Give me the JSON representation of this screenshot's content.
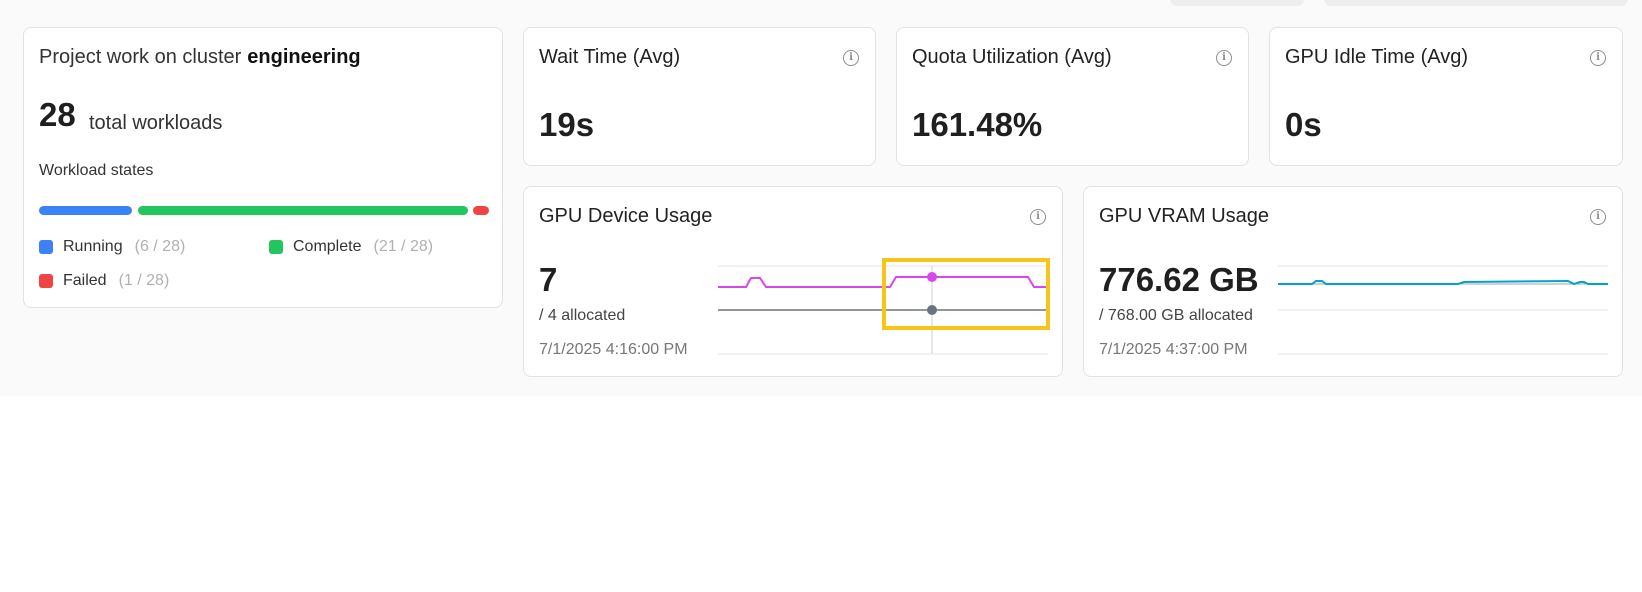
{
  "project": {
    "title_prefix": "Project work on cluster",
    "cluster": "engineering",
    "total": "28",
    "total_label": "total workloads",
    "states_label": "Workload states",
    "states": [
      {
        "name": "Running",
        "count": "(6 / 28)",
        "value": 6,
        "color": "#3b82f6"
      },
      {
        "name": "Complete",
        "count": "(21 / 28)",
        "value": 21,
        "color": "#22c55e"
      },
      {
        "name": "Failed",
        "count": "(1 / 28)",
        "value": 1,
        "color": "#ef4444"
      }
    ]
  },
  "metrics": [
    {
      "title": "Wait Time (Avg)",
      "value": "19s",
      "icon": "info-icon"
    },
    {
      "title": "Quota Utilization (Avg)",
      "value": "161.48%",
      "icon": "info-icon"
    },
    {
      "title": "GPU Idle Time (Avg)",
      "value": "0s",
      "icon": "info-icon"
    }
  ],
  "gpu_device": {
    "title": "GPU Device Usage",
    "value": "7",
    "allocated": "/ 4 allocated",
    "timestamp": "7/1/2025 4:16:00 PM",
    "colors": {
      "usage": "#d946ef",
      "allocated": "#6b7280"
    }
  },
  "gpu_vram": {
    "title": "GPU VRAM Usage",
    "value": "776.62 GB",
    "allocated": "/ 768.00 GB allocated",
    "timestamp": "7/1/2025 4:37:00 PM",
    "colors": {
      "usage": "#06a3c8",
      "allocated": "#9ca3af"
    }
  }
}
